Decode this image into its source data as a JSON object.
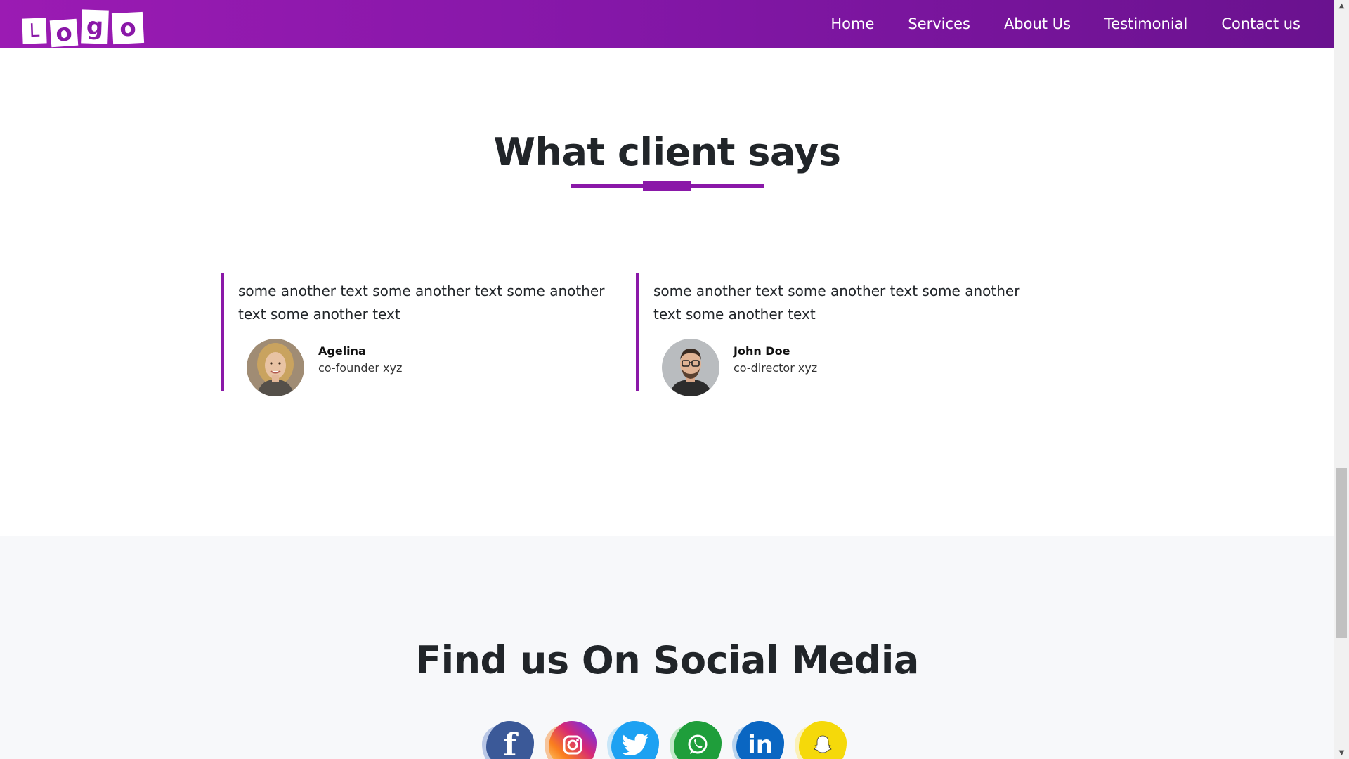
{
  "navbar": {
    "logo_letters": [
      "L",
      "o",
      "g",
      "o"
    ],
    "links": [
      "Home",
      "Services",
      "About Us",
      "Testimonial",
      "Contact us"
    ],
    "gradient_colors": [
      "#9b1bb3",
      "#6a128f"
    ]
  },
  "testimonials": {
    "title": "What client says",
    "accent_color": "#8a18a8",
    "cards": [
      {
        "text": "some another text some another text some another text some another text",
        "name": "Agelina",
        "role": "co-founder xyz",
        "avatar": "woman-portrait"
      },
      {
        "text": "some another text some another text some another text some another text",
        "name": "John Doe",
        "role": "co-director xyz",
        "avatar": "man-portrait"
      }
    ]
  },
  "social": {
    "title": "Find us On Social Media",
    "icons": [
      {
        "name": "facebook-icon",
        "glyph": "f",
        "color": "#3b5998"
      },
      {
        "name": "instagram-icon",
        "glyph": "◎",
        "color": "#d62976"
      },
      {
        "name": "twitter-icon",
        "glyph": "🐦",
        "color": "#1da1f2"
      },
      {
        "name": "whatsapp-icon",
        "glyph": "✆",
        "color": "#25a244"
      },
      {
        "name": "linkedin-icon",
        "glyph": "in",
        "color": "#0a66c2"
      },
      {
        "name": "snapchat-icon",
        "glyph": "👻",
        "color": "#fff000"
      }
    ]
  }
}
